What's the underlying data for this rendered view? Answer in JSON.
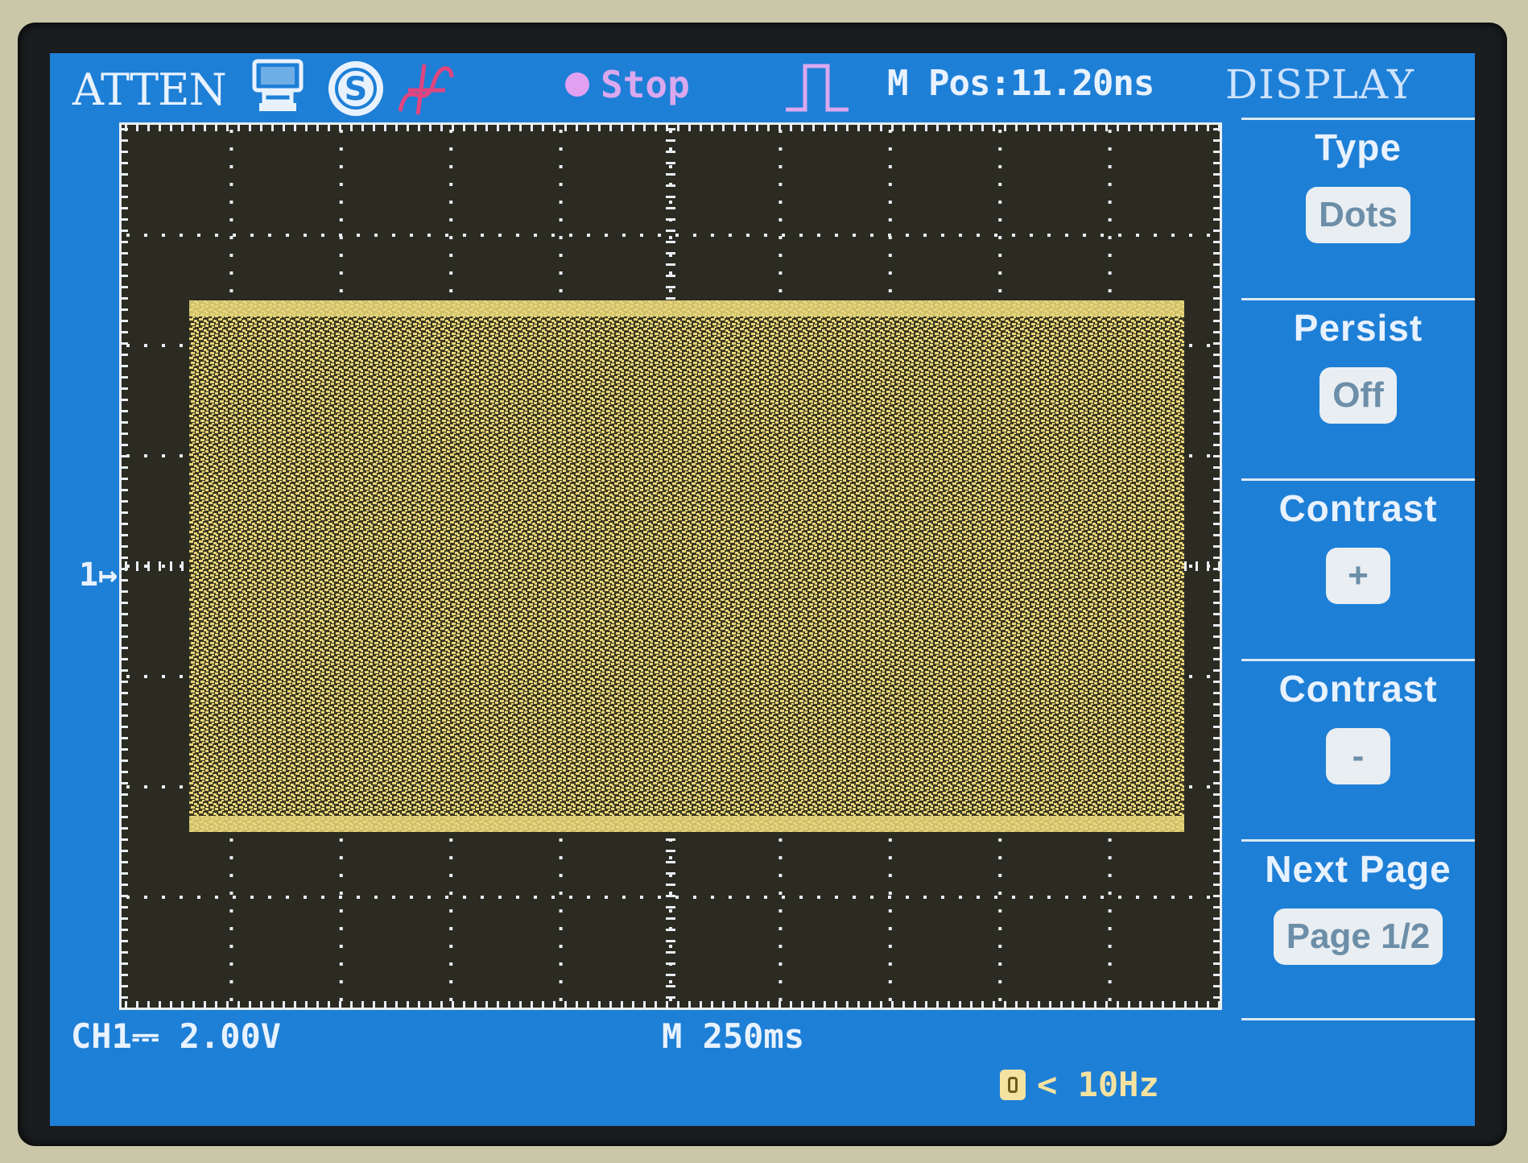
{
  "header": {
    "brand": "ATTEN",
    "run_state": "Stop",
    "m_pos": "M Pos:11.20ns",
    "menu_title": "DISPLAY"
  },
  "menu": {
    "items": [
      {
        "label": "Type",
        "value": "Dots"
      },
      {
        "label": "Persist",
        "value": "Off"
      },
      {
        "label": "Contrast",
        "value": "+"
      },
      {
        "label": "Contrast",
        "value": "-"
      },
      {
        "label": "Next Page",
        "value": "Page 1/2"
      }
    ]
  },
  "plot": {
    "channel_marker": "1",
    "trace_color": "#e8d67a",
    "grid_color": "#e8eef2"
  },
  "footer": {
    "ch1_scale": "CH1⎓ 2.00V",
    "timebase": "M 250ms",
    "trigger_freq": "< 10Hz"
  },
  "colors": {
    "screen_bg": "#1e7fd6",
    "plot_bg": "#2b2b22",
    "stop_color": "#d9a8ee"
  }
}
